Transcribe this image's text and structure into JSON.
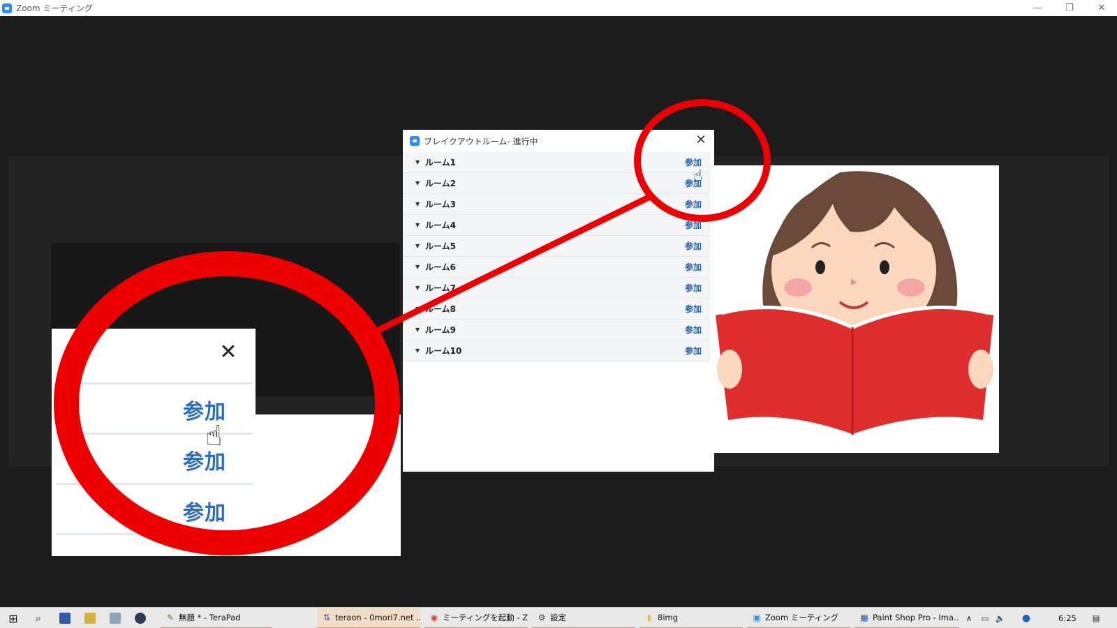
{
  "window": {
    "title": "Zoom ミーティング",
    "controls": {
      "minimize": "—",
      "restore": "❐",
      "close": "✕"
    }
  },
  "dialog": {
    "title": "ブレイクアウトルーム- 進行中",
    "close_label": "✕",
    "join_label": "参加",
    "rooms": [
      "ルーム1",
      "ルーム2",
      "ルーム3",
      "ルーム4",
      "ルーム5",
      "ルーム6",
      "ルーム7",
      "ルーム8",
      "ルーム9",
      "ルーム10"
    ]
  },
  "zoomed_inset": {
    "close_label": "✕",
    "join_label": "参加"
  },
  "taskbar": {
    "apps": [
      {
        "label": "無題 * - TeraPad",
        "icon": "terapad-icon"
      },
      {
        "label": "teraon - 0mori7.net ...",
        "icon": "ftp-icon"
      },
      {
        "label": "ミーティングを起動 - Zo...",
        "icon": "chrome-icon"
      },
      {
        "label": "設定",
        "icon": "gear-icon"
      },
      {
        "label": "8img",
        "icon": "folder-icon"
      },
      {
        "label": "Zoom ミーティング",
        "icon": "zoom-icon"
      },
      {
        "label": "Paint Shop Pro - Ima...",
        "icon": "paintshop-icon"
      }
    ],
    "clock": "6:25"
  },
  "colors": {
    "annotation": "#ee0000",
    "link": "#1f63b4",
    "zoom_blue": "#2d8cff",
    "stage_bg": "#232323",
    "meeting_bg": "#1c1c1c"
  }
}
